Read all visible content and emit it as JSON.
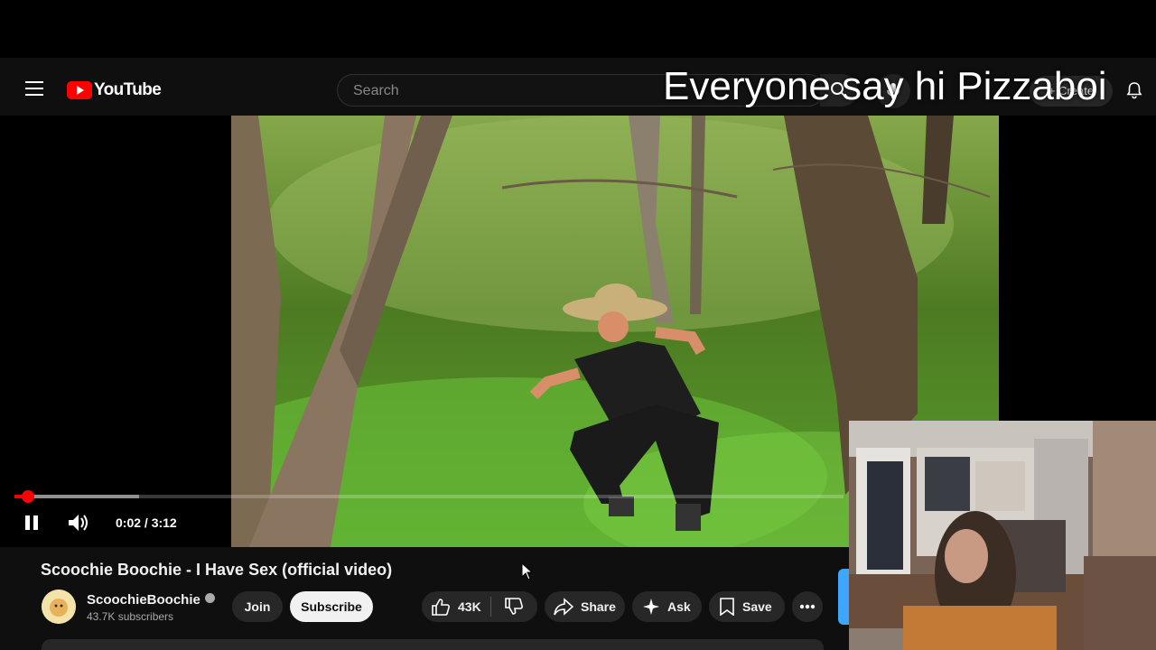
{
  "overlay": {
    "text": "Everyone say hi Pizzaboi"
  },
  "header": {
    "logo_text": "YouTube",
    "search_placeholder": "Search",
    "create_label": "Create"
  },
  "player": {
    "time": "0:02 / 3:12",
    "progress_fraction": 0.0104
  },
  "video": {
    "title": "Scoochie Boochie - I Have Sex (official video)",
    "channel_name": "ScoochieBoochie",
    "subscribers": "43.7K subscribers"
  },
  "actions": {
    "join": "Join",
    "subscribe": "Subscribe",
    "likes": "43K",
    "share": "Share",
    "ask": "Ask",
    "save": "Save"
  },
  "colors": {
    "accent": "#ff0000",
    "background": "#0f0f0f",
    "pill": "#272727"
  },
  "icons": [
    "menu-icon",
    "youtube-logo-icon",
    "search-icon",
    "mic-icon",
    "create-icon",
    "bell-icon",
    "pause-icon",
    "volume-icon",
    "cursor-icon",
    "like-icon",
    "dislike-icon",
    "share-icon",
    "sparkle-icon",
    "save-icon",
    "more-icon",
    "verified-icon"
  ]
}
